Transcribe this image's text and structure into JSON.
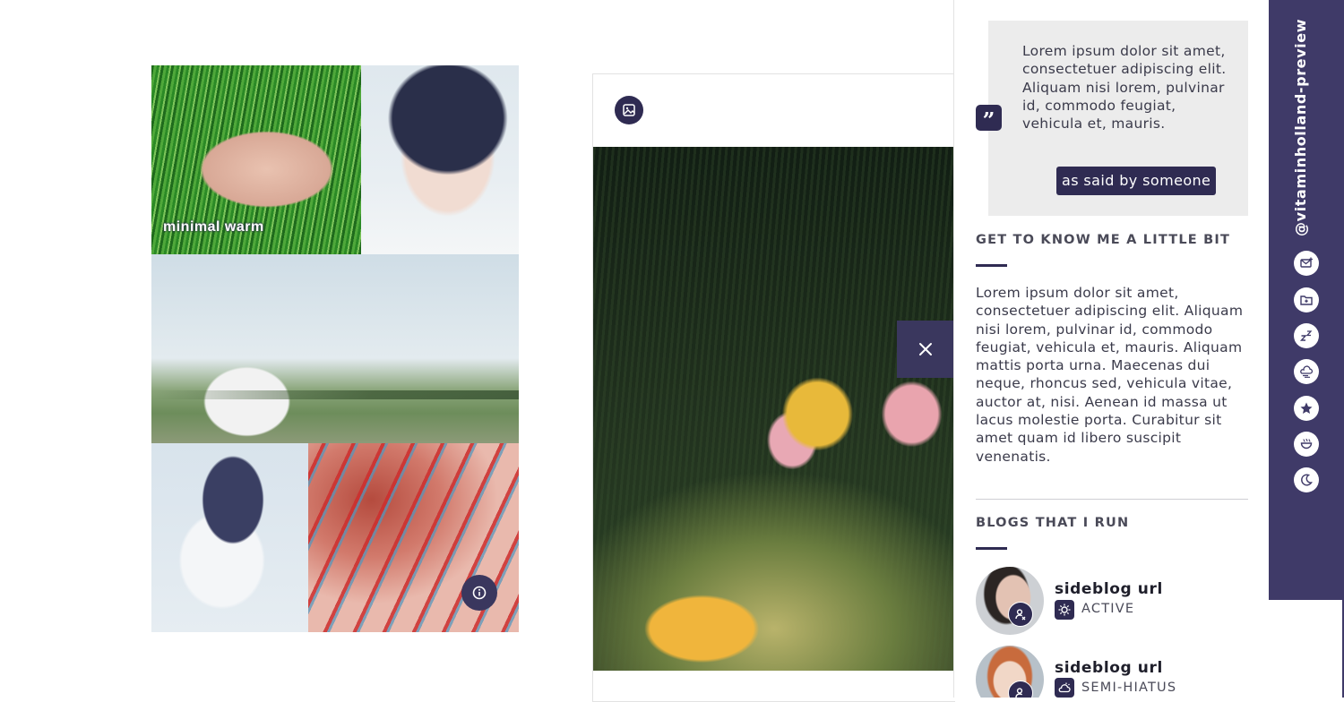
{
  "collage_post": {
    "caption": "minimal warm",
    "info_icon": "info-icon"
  },
  "photo_post": {
    "type_icon": "image-icon",
    "close_icon": "close-icon"
  },
  "sidebar": {
    "quote": {
      "icon": "quote-icon",
      "text": "Lorem ipsum dolor sit amet, consectetuer adipiscing elit. Aliquam nisi lorem, pulvinar id, commodo feugiat, vehicula et, mauris.",
      "author": "as said by someone"
    },
    "about": {
      "title": "GET TO KNOW ME A LITTLE BIT",
      "text": "Lorem ipsum dolor sit amet, consectetuer adipiscing elit. Aliquam nisi lorem, pulvinar id, commodo feugiat, vehicula et, mauris. Aliquam mattis porta urna. Maecenas dui neque, rhoncus sed, vehicula vitae, auctor at, nisi. Aenean id massa ut lacus molestie porta. Curabitur sit amet quam id libero suscipit venenatis."
    },
    "blogs": {
      "title": "BLOGS THAT I RUN",
      "items": [
        {
          "url": "sideblog url",
          "status": "ACTIVE",
          "status_icon": "sun-icon",
          "badge_icon": "user-icon"
        },
        {
          "url": "sideblog url",
          "status": "SEMI-HIATUS",
          "status_icon": "cloud-sun-icon",
          "badge_icon": "user-icon"
        }
      ]
    }
  },
  "vertical_bar": {
    "username": "@vitaminholland-preview",
    "icons": [
      "mail-plus-icon",
      "folder-icon",
      "sleep-zz-icon",
      "weather-icon",
      "star-badge-icon",
      "smile-bowl-icon",
      "moon-icon"
    ]
  },
  "colors": {
    "accent": "#2f2b52",
    "bar": "#3f3a68",
    "quote_bg": "#ececec"
  }
}
